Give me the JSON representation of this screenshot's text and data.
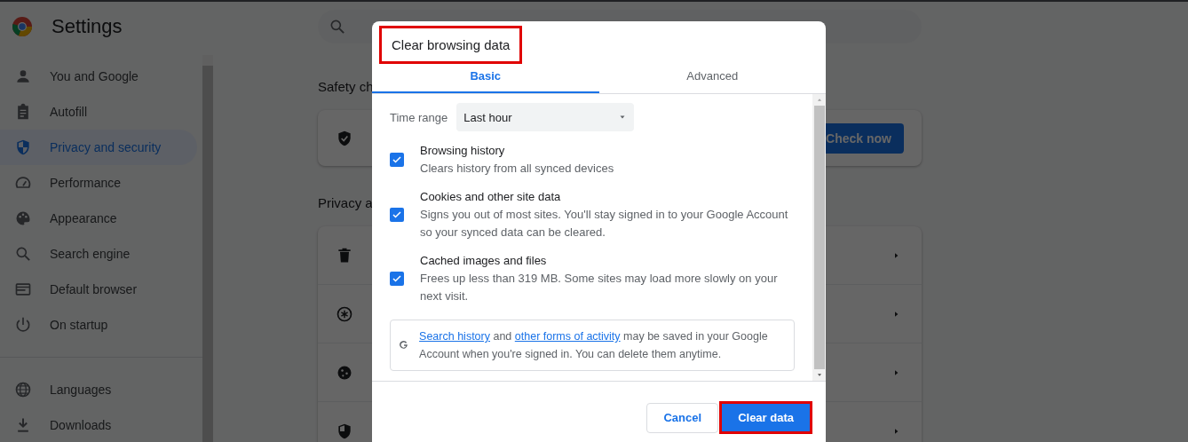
{
  "app": {
    "title": "Settings"
  },
  "sidebar": {
    "sections": [
      {
        "items": [
          {
            "label": "You and Google",
            "selected": false
          },
          {
            "label": "Autofill",
            "selected": false
          },
          {
            "label": "Privacy and security",
            "selected": true
          },
          {
            "label": "Performance",
            "selected": false
          },
          {
            "label": "Appearance",
            "selected": false
          },
          {
            "label": "Search engine",
            "selected": false
          },
          {
            "label": "Default browser",
            "selected": false
          },
          {
            "label": "On startup",
            "selected": false
          }
        ]
      },
      {
        "items": [
          {
            "label": "Languages",
            "selected": false
          },
          {
            "label": "Downloads",
            "selected": false
          }
        ]
      }
    ]
  },
  "main": {
    "safety_check": {
      "heading": "Safety ch",
      "button": "Check now"
    },
    "privacy": {
      "heading": "Privacy a"
    }
  },
  "dialog": {
    "title": "Clear browsing data",
    "title_annotated": true,
    "tabs": [
      {
        "label": "Basic",
        "selected": true
      },
      {
        "label": "Advanced",
        "selected": false
      }
    ],
    "time_range": {
      "label": "Time range",
      "value": "Last hour"
    },
    "items": [
      {
        "title": "Browsing history",
        "description": "Clears history from all synced devices",
        "checked": true
      },
      {
        "title": "Cookies and other site data",
        "description": "Signs you out of most sites. You'll stay signed in to your Google Account so your synced data can be cleared.",
        "checked": true
      },
      {
        "title": "Cached images and files",
        "description": "Frees up less than 319 MB. Some sites may load more slowly on your next visit.",
        "checked": true
      }
    ],
    "info": {
      "segments": [
        {
          "text": "Search history",
          "link": true
        },
        {
          "text": " and ",
          "link": false
        },
        {
          "text": "other forms of activity",
          "link": true
        },
        {
          "text": " may be saved in your Google Account when you're signed in. You can delete them anytime.",
          "link": false
        }
      ]
    },
    "buttons": [
      {
        "label": "Cancel",
        "kind": "secondary",
        "annotated": false
      },
      {
        "label": "Clear data",
        "kind": "primary",
        "annotated": true
      }
    ]
  }
}
